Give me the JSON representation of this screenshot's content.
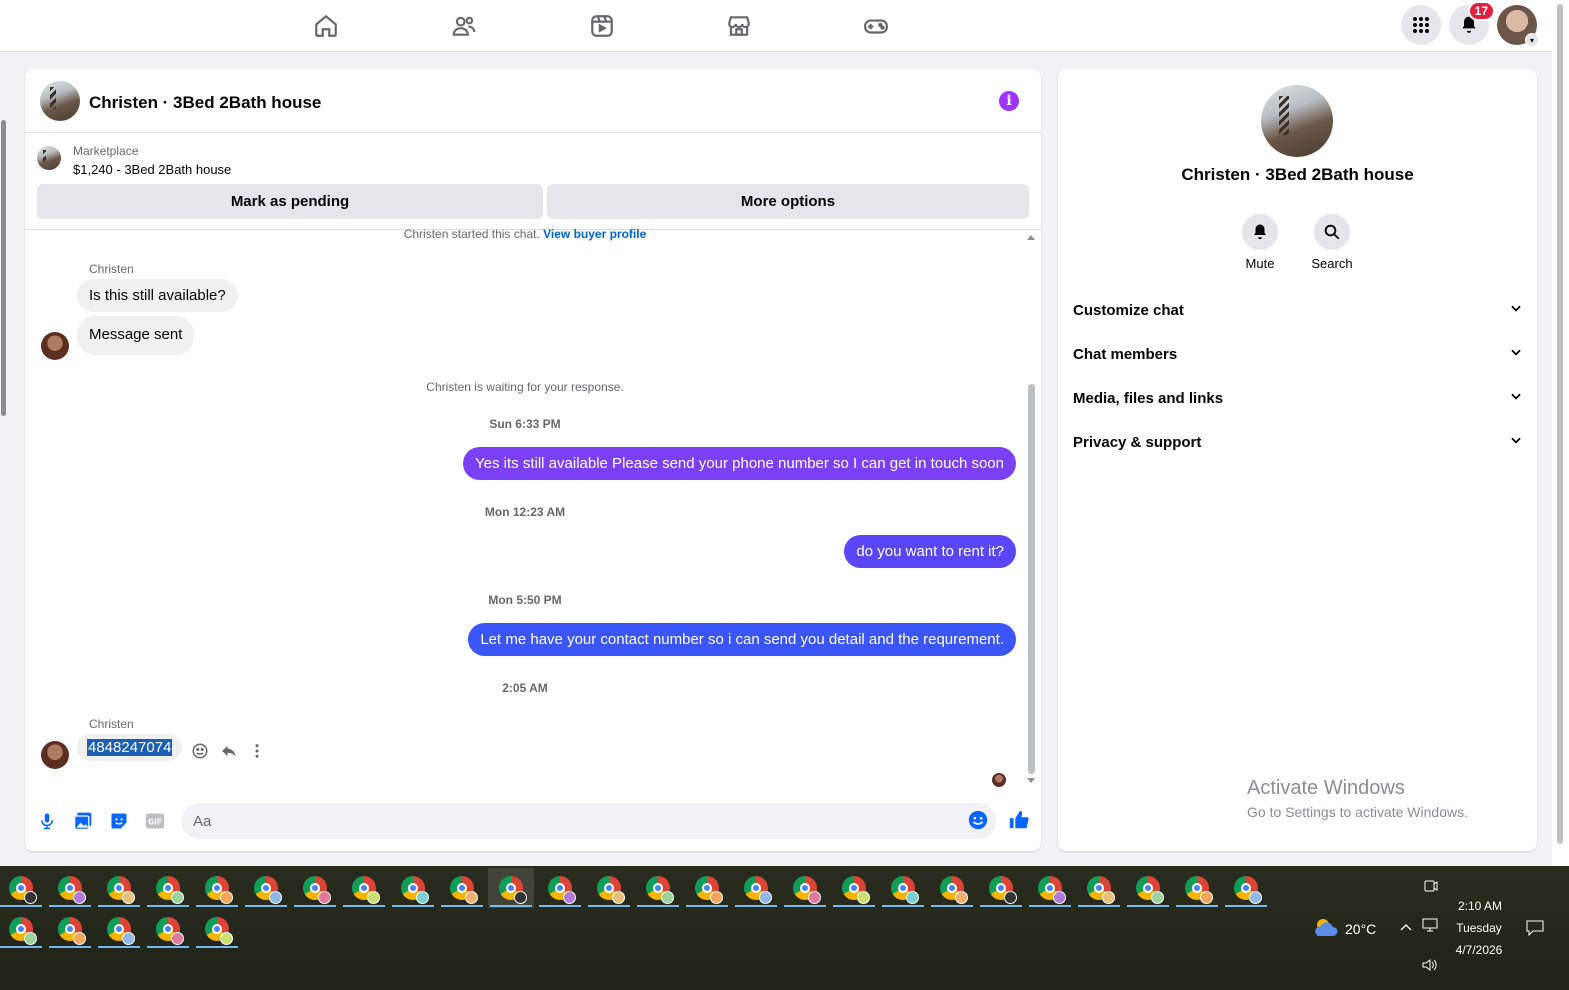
{
  "nav": {
    "icons": [
      "home-icon",
      "friends-icon",
      "video-icon",
      "marketplace-icon",
      "gaming-icon"
    ],
    "notification_count": "17"
  },
  "chat": {
    "title": "Christen · 3Bed 2Bath house",
    "marketplace_label": "Marketplace",
    "listing": "$1,240 - 3Bed 2Bath house",
    "mark_pending": "Mark as pending",
    "more_options": "More options",
    "started_text": "Christen started this chat.",
    "view_buyer": "View buyer profile",
    "sender": "Christen",
    "msg1": "Is this still available?",
    "msg2": "Message sent",
    "waiting": "Christen is waiting for your response.",
    "ts1": "Sun 6:33 PM",
    "out1": "Yes its still available Please send your phone number so I can get in touch soon",
    "ts2": "Mon 12:23 AM",
    "out2": "do you want to rent it?",
    "ts3": "Mon 5:50 PM",
    "out3": "Let me have your contact number so i can send you detail and the requrement.",
    "ts4": "2:05 AM",
    "sender2": "Christen",
    "msg3": "4848247074",
    "composer_placeholder": "Aa",
    "colors": {
      "out_gradient_top": "#8b3dff",
      "out_gradient_bottom": "#2f5cff",
      "accent": "#a033ff"
    }
  },
  "side": {
    "title": "Christen · 3Bed 2Bath house",
    "mute": "Mute",
    "search": "Search",
    "rows": [
      "Customize chat",
      "Chat members",
      "Media, files and links",
      "Privacy & support"
    ]
  },
  "watermark": {
    "line1": "Activate Windows",
    "line2": "Go to Settings to activate Windows."
  },
  "taskbar": {
    "weather": "20°C",
    "time": "2:10 AM",
    "day": "Tuesday",
    "date": "4/7/2026"
  }
}
